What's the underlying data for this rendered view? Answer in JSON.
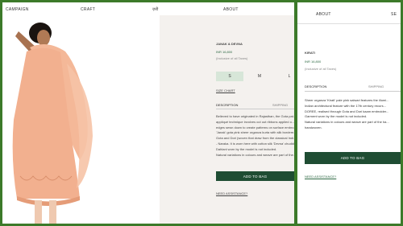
{
  "left": {
    "nav": [
      "CAMPAIGN",
      "CRAFT",
      "ज़री",
      "ABOUT"
    ],
    "brand": "JANAK & DEVNA",
    "price": "INR 16,800",
    "tax_note": "(Inclusive of all Taxes)",
    "sizes": [
      "S",
      "M",
      "L"
    ],
    "size_chart": "SIZE CHART",
    "tabs": {
      "description": "DESCRIPTION",
      "shipping": "SHIPPING"
    },
    "description_lines": [
      "Believed to have originated in Rajasthan, the Gota pat...",
      "appliqué technique involves cut out ribbons applied o...",
      "edges sewn down to create patterns on surface embro...",
      "'Janak' gota pink sheer organza kurta with silk bordere...",
      "Gota and Dori (woven that draw from the classical Indi...",
      "- Naraka. It is worn here with cotton silk 'Devna' chudid...",
      "Dahlani worn by the model is not included.",
      "",
      "Natural variations in colours and weave are part of the..."
    ],
    "add_to_bag": "ADD TO BAG",
    "assistance": "NEED ASSISTANCE?"
  },
  "right": {
    "nav": [
      "ABOUT",
      "SE"
    ],
    "brand": "KIRATI",
    "price": "INR 16,800",
    "tax_note": "(Inclusive of all Taxes)",
    "tabs": {
      "description": "DESCRIPTION",
      "shipping": "SHIPPING"
    },
    "description_lines": [
      "Sheer organza 'Kirati' pale pink salwari features the illumi...",
      "Indian architectural feature with the 17th century recurs...",
      "DOREE, realised through Gota and Dori kaam embroider...",
      "",
      "Garment worn by the model is not included.",
      "",
      "Natural variations in colours and weave are part of the ha...",
      "handwoven."
    ],
    "add_to_bag": "ADD TO BAG",
    "assistance": "NEED ASSISTANCE?"
  },
  "colors": {
    "frame": "#3c7a2a",
    "button": "#1f4d33",
    "selected_size": "#d7e6d8",
    "garment": "#f2b08f"
  }
}
